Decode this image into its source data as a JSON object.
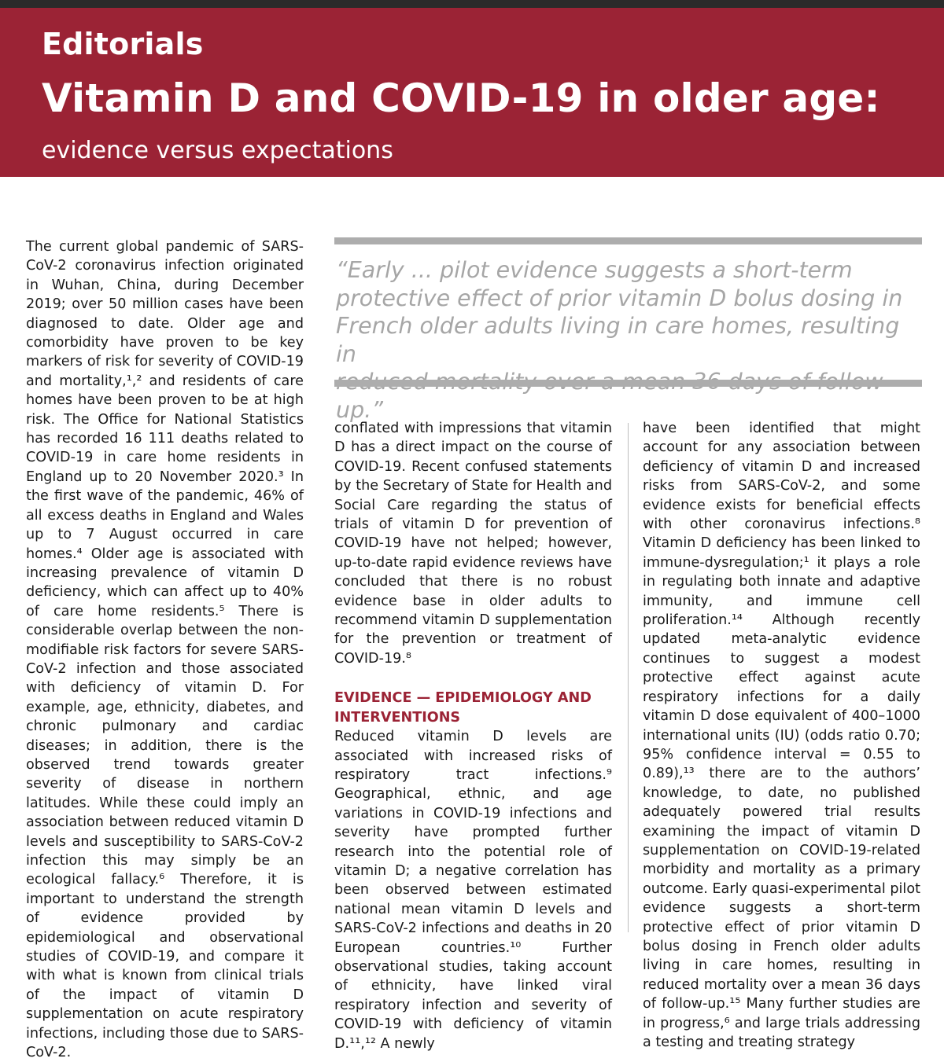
{
  "header": {
    "section": "Editorials",
    "title": "Vitamin D and COVID-19 in older age:",
    "subtitle": "evidence versus expectations"
  },
  "pull_quote": "“Early ... pilot evidence suggests a short-term\nprotective effect of prior vitamin D bolus dosing in\nFrench older adults living in care homes, resulting in\nreduced mortality over a mean 36 days of follow-up.”",
  "column1": {
    "text": "The current global pandemic of SARS-CoV-2 coronavirus infection originated in Wuhan, China, during December 2019; over 50 million cases have been diagnosed to date. Older age and comorbidity have proven to be key markers of risk for severity of COVID-19 and mortality,¹,² and residents of care homes have been proven to be at high risk. The Office for National Statistics has recorded 16 111 deaths related to COVID-19 in care home residents in England up to 20 November 2020.³ In the first wave of the pandemic, 46% of all excess deaths in England and Wales up to 7 August occurred in care homes.⁴ Older age is associated with increasing prevalence of vitamin D deficiency, which can affect up to 40% of care home residents.⁵ There is considerable overlap between the non-modifiable risk factors for severe SARS-CoV-2 infection and those associated with deficiency of vitamin D. For example, age, ethnicity, diabetes, and chronic pulmonary and cardiac diseases; in addition, there is the observed trend towards greater severity of disease in northern latitudes. While these could imply an association between reduced vitamin D levels and susceptibility to SARS-CoV-2 infection this may simply be an ecological fallacy.⁶ Therefore, it is important to understand the strength of evidence provided by epidemiological and observational studies of COVID-19, and compare it with what is known from clinical trials of the impact of vitamin D supplementation on acute respiratory infections, including those due to SARS-CoV-2."
  },
  "column2": {
    "text_top": "conflated with impressions that vitamin D has a direct impact on the course of COVID-19. Recent confused statements by the Secretary of State for Health and Social Care regarding the status of trials of vitamin D for prevention of COVID-19 have not helped; however, up-to-date rapid evidence reviews have concluded that there is no robust evidence base in older adults to recommend vitamin D supplementation for the prevention or treatment of COVID-19.⁸",
    "heading": "Evidence — Epidemiology and Interventions",
    "text_bottom": "Reduced vitamin D levels are associated with increased risks of respiratory tract infections.⁹ Geographical, ethnic, and age variations in COVID-19 infections and severity have prompted further research into the potential role of vitamin D; a negative correlation has been observed between estimated national mean vitamin D levels and SARS-CoV-2 infections and deaths in 20 European countries.¹⁰ Further observational studies, taking account of ethnicity, have linked viral respiratory infection and severity of COVID-19 with deficiency of vitamin D.¹¹,¹² A newly"
  },
  "column3": {
    "text": "have been identified that might account for any association between deficiency of vitamin D and increased risks from SARS-CoV-2, and some evidence exists for beneficial effects with other coronavirus infections.⁸ Vitamin D deficiency has been linked to immune-dysregulation;¹ it plays a role in regulating both innate and adaptive immunity, and immune cell proliferation.¹⁴ Although recently updated meta-analytic evidence continues to suggest a modest protective effect against acute respiratory infections for a daily vitamin D dose equivalent of 400–1000 international units (IU) (odds ratio 0.70; 95% confidence interval = 0.55 to 0.89),¹³ there are to the authors’ knowledge, to date, no published adequately powered trial results examining the impact of vitamin D supplementation on COVID-19-related morbidity and mortality as a primary outcome. Early quasi-experimental pilot evidence suggests a short-term protective effect of prior vitamin D bolus dosing in French older adults living in care homes, resulting in reduced mortality over a mean 36 days of follow-up.¹⁵ Many further studies are in progress,⁶ and large trials addressing a testing and treating strategy"
  },
  "colors": {
    "banner": "#9b2335",
    "heading": "#9b2335",
    "pull_quote_text": "#a6a6a6",
    "pull_quote_rule": "#adadad"
  }
}
